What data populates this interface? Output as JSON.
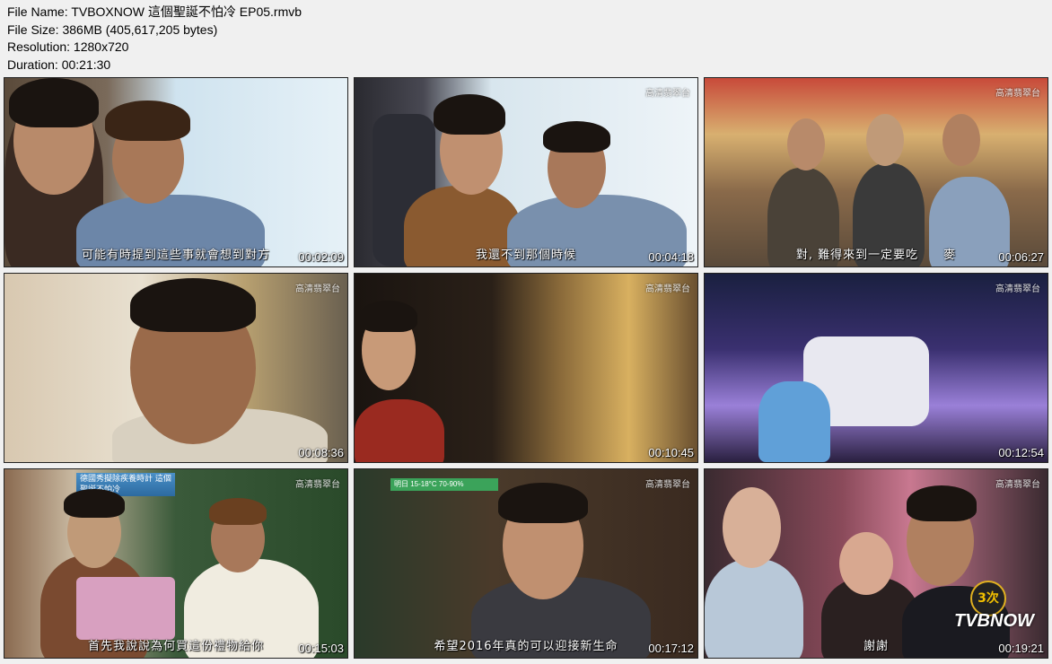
{
  "info": {
    "file_name": "File Name: TVBOXNOW 這個聖誕不怕冷 EP05.rmvb",
    "file_size": "File Size: 386MB (405,617,205 bytes)",
    "resolution": "Resolution: 1280x720",
    "duration": "Duration: 00:21:30"
  },
  "thumbnails": [
    {
      "timestamp": "00:02:09",
      "subtitle": "可能有時提到這些事就會想到對方"
    },
    {
      "timestamp": "00:04:18",
      "subtitle": "我還不到那個時候"
    },
    {
      "timestamp": "00:06:27",
      "subtitle": "對, 難得來到一定要吃　　麥"
    },
    {
      "timestamp": "00:08:36",
      "subtitle": ""
    },
    {
      "timestamp": "00:10:45",
      "subtitle": ""
    },
    {
      "timestamp": "00:12:54",
      "subtitle": ""
    },
    {
      "timestamp": "00:15:03",
      "subtitle": "首先我說說為何買這份禮物給你"
    },
    {
      "timestamp": "00:17:12",
      "subtitle": "希望2016年真的可以迎接新生命"
    },
    {
      "timestamp": "00:19:21",
      "subtitle": "謝謝"
    }
  ],
  "channel_logo": "高清翡翠台",
  "banner_text": "德國秀擬除疾養時計 這個聖誕不怕冷",
  "weather_text": "明日 15-18°C 70-90%",
  "badge": {
    "count": "3次",
    "brand": "TVBNOW"
  }
}
